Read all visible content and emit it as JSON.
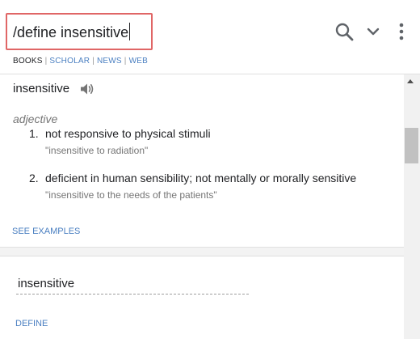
{
  "header": {
    "search_value": "/define insensitive",
    "icons": {
      "search": "search-icon",
      "expand": "chevron-down-icon",
      "more": "more-vertical-icon"
    }
  },
  "sources": {
    "items": [
      {
        "label": "BOOKS",
        "active": true
      },
      {
        "label": "SCHOLAR",
        "active": false
      },
      {
        "label": "NEWS",
        "active": false
      },
      {
        "label": "WEB",
        "active": false
      }
    ]
  },
  "definition": {
    "word": "insensitive",
    "audio_icon": "speaker-icon",
    "part_of_speech": "adjective",
    "senses": [
      {
        "number": "1.",
        "text": "not responsive to physical stimuli",
        "example": "\"insensitive to radiation\""
      },
      {
        "number": "2.",
        "text": "deficient in human sensibility; not mentally or morally sensitive",
        "example": "\"insensitive to the needs of the patients\""
      }
    ],
    "see_examples_label": "SEE EXAMPLES"
  },
  "define_panel": {
    "input_value": "insensitive",
    "button_label": "DEFINE"
  },
  "colors": {
    "accent_link": "#4a7fc1",
    "search_highlight_border": "#e06666",
    "muted_text": "#757575"
  }
}
